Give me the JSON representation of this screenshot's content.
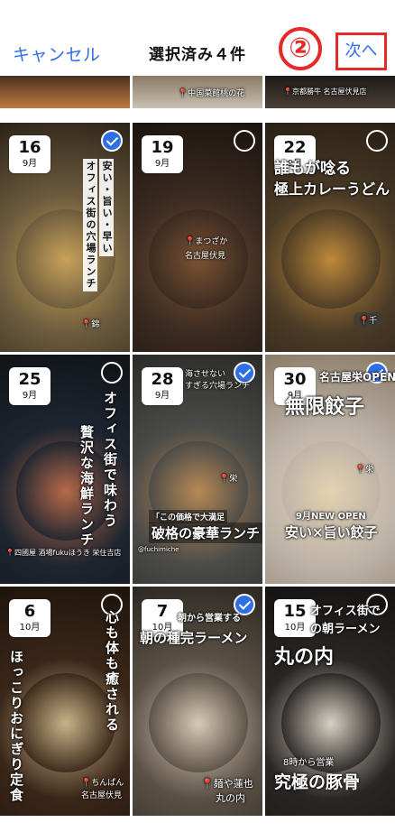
{
  "header": {
    "cancel_label": "キャンセル",
    "title": "選択済み４件",
    "annotation_number": "②",
    "next_label": "次へ"
  },
  "top_strip": {
    "middle_location": "中国菜館桃の花",
    "right_location": "京都勝牛 名古屋伏見店"
  },
  "posts": [
    {
      "day": "16",
      "month": "9月",
      "selected": true,
      "caption": "安い・旨い・早い",
      "caption2": "オフィス街の穴場ランチ",
      "location": "錦",
      "colors": [
        "#6b5a3d",
        "#c9a25a",
        "#2b2218"
      ]
    },
    {
      "day": "19",
      "month": "9月",
      "selected": false,
      "caption": "",
      "caption2": "",
      "location": "まつざか",
      "location2": "名古屋伏見",
      "colors": [
        "#3a2a20",
        "#7a5233",
        "#1b1410"
      ]
    },
    {
      "day": "22",
      "month": "9月",
      "selected": false,
      "caption": "誰もが唸る",
      "caption2": "極上カレーうどん",
      "location": "千",
      "colors": [
        "#4a3a26",
        "#c08a3a",
        "#2a2015"
      ]
    },
    {
      "day": "25",
      "month": "9月",
      "selected": false,
      "caption": "オフィス街で味わう",
      "caption2": "贅沢な海鮮ランチ",
      "location": "四國屋 酒場fukuほうき 栄住吉店",
      "colors": [
        "#1e2530",
        "#b86a4a",
        "#101418"
      ]
    },
    {
      "day": "28",
      "month": "9月",
      "selected": true,
      "caption": "「この価格で大満足",
      "caption2": "破格の豪華ランチ",
      "top": "海させない",
      "top2": "すぎる穴場ランチ",
      "handle": "@fuchimiche",
      "location": "栄",
      "colors": [
        "#4a4a48",
        "#b88a55",
        "#2a2a28"
      ]
    },
    {
      "day": "30",
      "month": "9月",
      "selected": true,
      "caption": "無限餃子",
      "caption2": "安い×旨い餃子",
      "top": "名古屋栄OPEN！",
      "new": "9月NEW OPEN",
      "location": "栄",
      "colors": [
        "#bdb3a8",
        "#e6d2b0",
        "#8a7a66"
      ]
    },
    {
      "day": "6",
      "month": "10月",
      "selected": false,
      "caption": "心も体も癒される",
      "caption2": "ほっこりおにぎり定食",
      "location": "ちんぱん",
      "location2": "名古屋伏見",
      "colors": [
        "#3a2618",
        "#c9b48a",
        "#1e140c"
      ]
    },
    {
      "day": "7",
      "month": "10月",
      "selected": true,
      "caption": "朝から営業する",
      "caption2": "朝の種完ラーメン",
      "location": "麺や蓮也",
      "location2": "丸の内",
      "colors": [
        "#5a5045",
        "#d8cbb6",
        "#2b2722"
      ]
    },
    {
      "day": "15",
      "month": "10月",
      "selected": false,
      "caption": "丸の内",
      "caption2": "究極の豚骨",
      "top": "オフィス街で",
      "top2": "の朝ラーメン",
      "sub": "8時から営業",
      "location": "",
      "colors": [
        "#2a2624",
        "#d9d2c5",
        "#151312"
      ]
    }
  ]
}
